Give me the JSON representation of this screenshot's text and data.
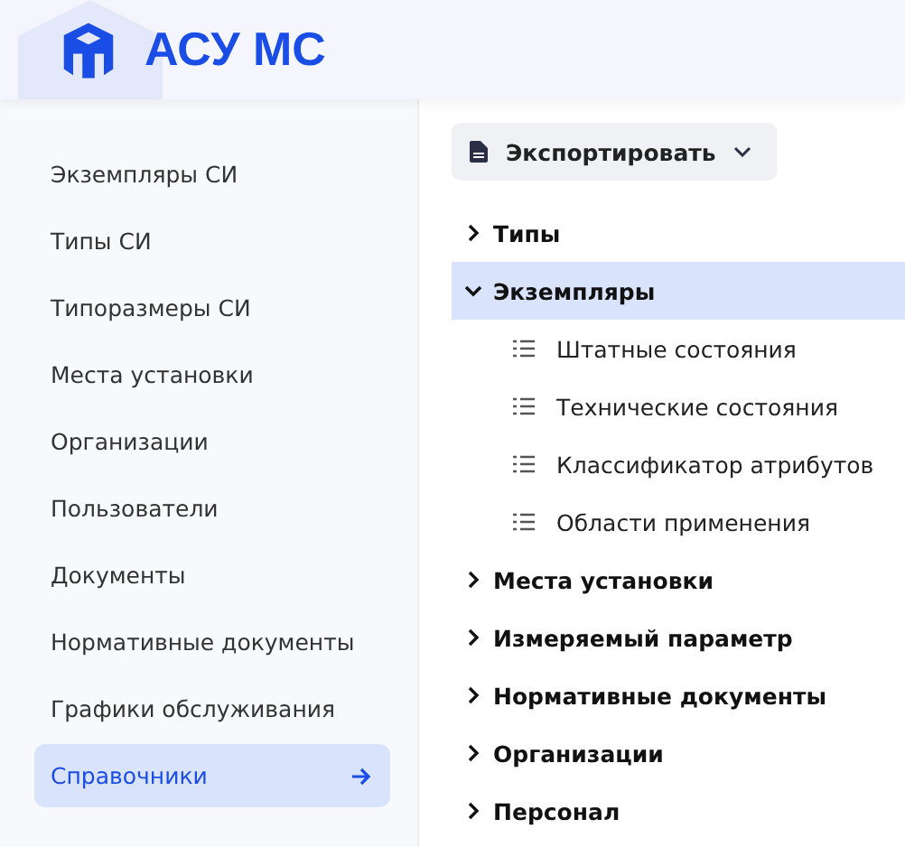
{
  "app": {
    "title": "АСУ МС"
  },
  "sidebar": {
    "items": [
      {
        "label": "Экземпляры СИ",
        "selected": false
      },
      {
        "label": "Типы СИ",
        "selected": false
      },
      {
        "label": "Типоразмеры СИ",
        "selected": false
      },
      {
        "label": "Места установки",
        "selected": false
      },
      {
        "label": "Организации",
        "selected": false
      },
      {
        "label": "Пользователи",
        "selected": false
      },
      {
        "label": "Документы",
        "selected": false
      },
      {
        "label": "Нормативные документы",
        "selected": false
      },
      {
        "label": "Графики обслуживания",
        "selected": false
      },
      {
        "label": "Справочники",
        "selected": true
      }
    ]
  },
  "toolbar": {
    "export_button": "Экспортировать"
  },
  "tree": [
    {
      "label": "Типы",
      "expanded": false,
      "selected": false
    },
    {
      "label": "Экземпляры",
      "expanded": true,
      "selected": true,
      "children": [
        {
          "label": "Штатные состояния"
        },
        {
          "label": "Технические состояния"
        },
        {
          "label": "Классификатор атрибутов"
        },
        {
          "label": "Области применения"
        }
      ]
    },
    {
      "label": "Места установки",
      "expanded": false,
      "selected": false
    },
    {
      "label": "Измеряемый параметр",
      "expanded": false,
      "selected": false
    },
    {
      "label": "Нормативные документы",
      "expanded": false,
      "selected": false
    },
    {
      "label": "Организации",
      "expanded": false,
      "selected": false
    },
    {
      "label": "Персонал",
      "expanded": false,
      "selected": false
    }
  ]
}
